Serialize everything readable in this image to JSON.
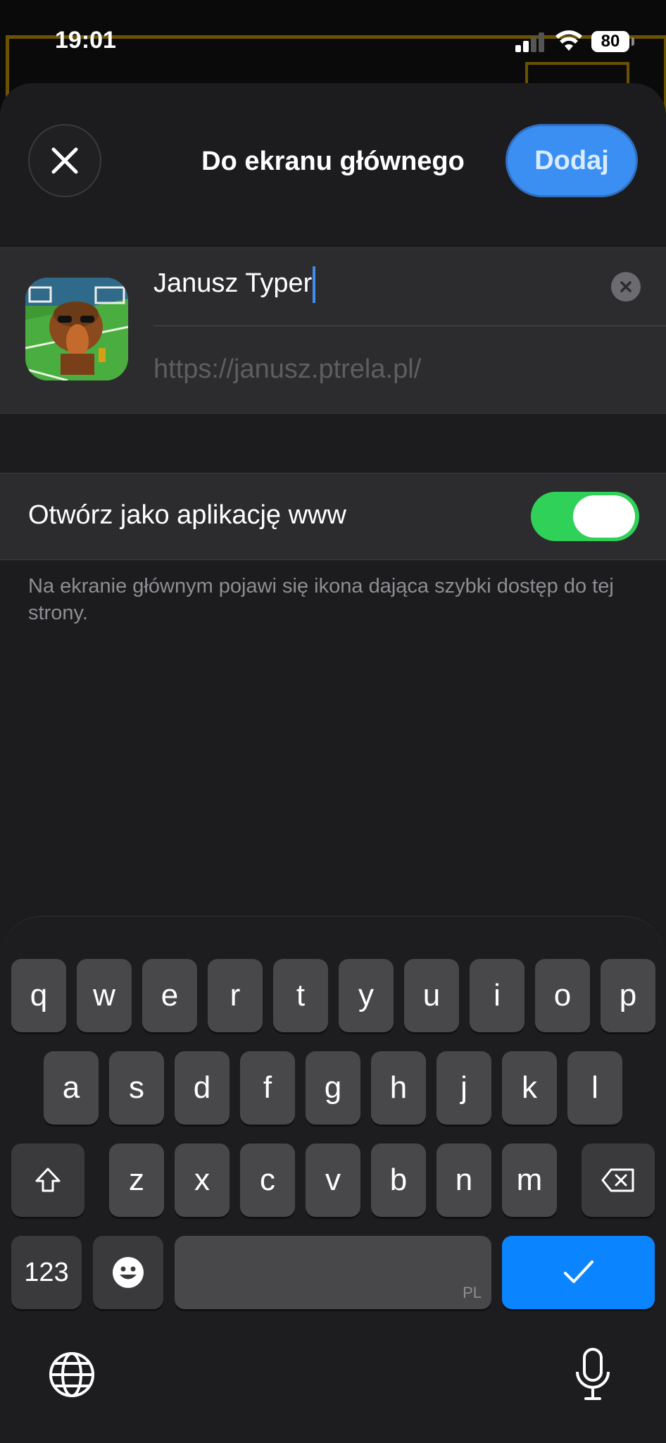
{
  "status_bar": {
    "time": "19:01",
    "battery": "80"
  },
  "sheet": {
    "title": "Do ekranu głównego",
    "add_label": "Dodaj",
    "name_value": "Janusz Typer",
    "url": "https://janusz.ptrela.pl/",
    "toggle_label": "Otwórz jako aplikację www",
    "toggle_on": true,
    "footer_note": "Na ekranie głównym pojawi się ikona dająca szybki dostęp do tej strony."
  },
  "keyboard": {
    "row1": [
      "q",
      "w",
      "e",
      "r",
      "t",
      "y",
      "u",
      "i",
      "o",
      "p"
    ],
    "row2": [
      "a",
      "s",
      "d",
      "f",
      "g",
      "h",
      "j",
      "k",
      "l"
    ],
    "row3": [
      "z",
      "x",
      "c",
      "v",
      "b",
      "n",
      "m"
    ],
    "numbers_label": "123",
    "language_hint": "PL"
  },
  "colors": {
    "accent": "#0a84ff",
    "toggle_on": "#30d158",
    "sheet_bg": "#1c1c1e"
  }
}
